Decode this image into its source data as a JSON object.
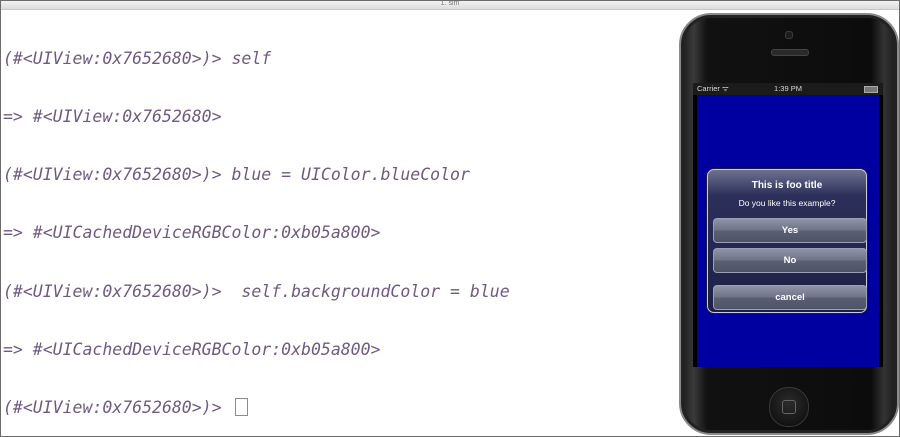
{
  "window": {
    "title": "1. sim"
  },
  "terminal": {
    "lines": [
      "(#<UIView:0x7652680>)> self",
      "=> #<UIView:0x7652680>",
      "(#<UIView:0x7652680>)> blue = UIColor.blueColor",
      "=> #<UICachedDeviceRGBColor:0xb05a800>",
      "(#<UIView:0x7652680>)>  self.backgroundColor = blue",
      "=> #<UICachedDeviceRGBColor:0xb05a800>"
    ],
    "prompt": "(#<UIView:0x7652680>)> "
  },
  "simulator": {
    "status": {
      "carrier": "Carrier ᯤ",
      "time": "1:39 PM"
    },
    "background_color": "#0000a0",
    "alert": {
      "title": "This is foo title",
      "message": "Do you like this example?",
      "buttons": {
        "yes": "Yes",
        "no": "No",
        "cancel": "cancel"
      }
    }
  },
  "icons": [
    "wifi-icon",
    "battery-icon",
    "home-button-icon",
    "camera-icon",
    "speaker-icon"
  ]
}
